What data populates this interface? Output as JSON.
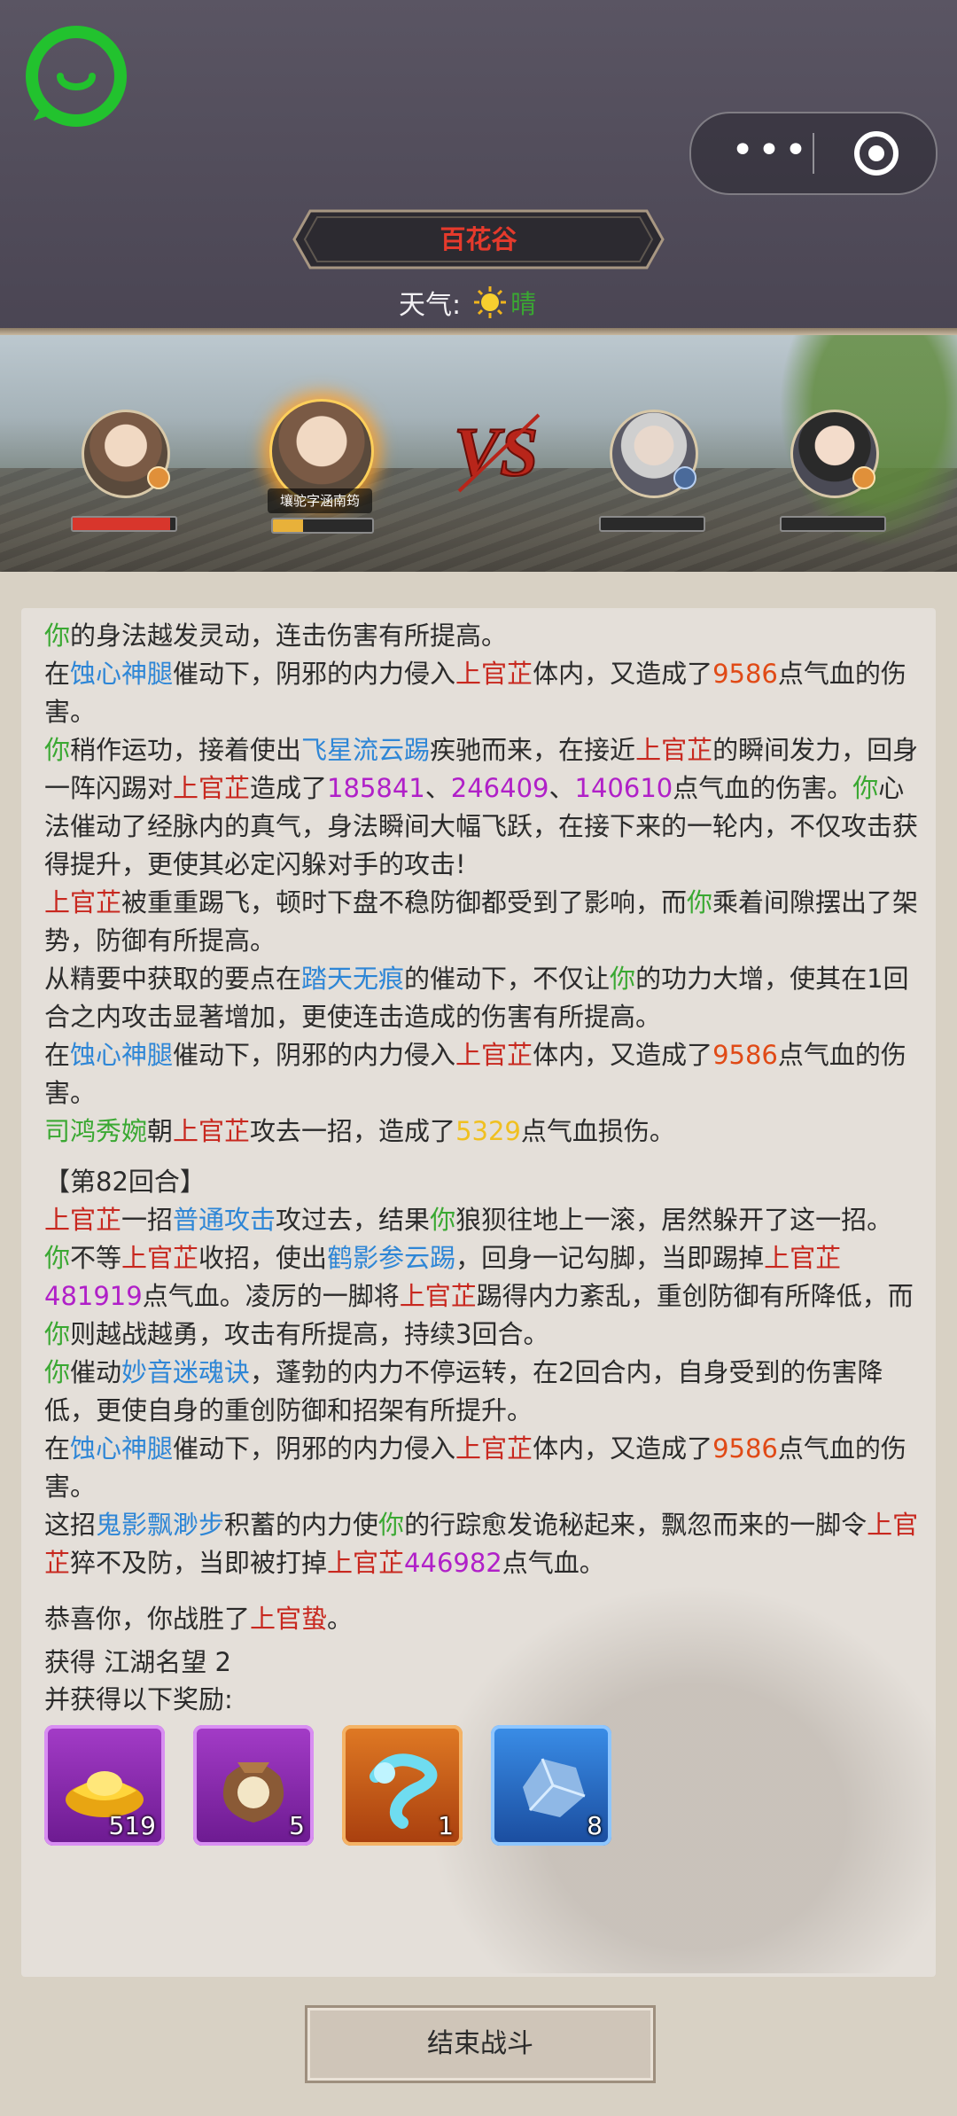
{
  "header": {
    "location": "百花谷",
    "weather_label": "天气:",
    "weather_value": "晴",
    "weather_icon": "sun-icon",
    "menu_icon": "more-dots-icon",
    "close_icon": "target-icon"
  },
  "battle": {
    "vs_text": "VS",
    "active_name": "壤驼字涵南筠",
    "left_team": [
      {
        "portrait": "female-warrior-portrait",
        "hp_fraction": 0.95
      },
      {
        "portrait": "fire-aura-hero-portrait",
        "hp_fraction": 0.3
      }
    ],
    "right_team": [
      {
        "portrait": "elder-portrait",
        "hp_fraction": 0
      },
      {
        "portrait": "female-scholar-portrait",
        "hp_fraction": 0
      }
    ]
  },
  "log": {
    "round_label": "【第82回合】",
    "lines": {
      "l1": [
        "你",
        "的身法越发灵动，连击伤害有所提高。"
      ],
      "l2": [
        "在",
        "蚀心神腿",
        "催动下，阴邪的内力侵入",
        "上官芷",
        "体内，又造成了",
        "9586",
        "点气血的伤害。"
      ],
      "l3": [
        "你",
        "稍作运功，接着使出",
        "飞星流云踢",
        "疾驰而来，在接近",
        "上官芷",
        "的瞬间发力，回身一阵闪踢对",
        "上官芷",
        "造成了",
        "185841",
        "、",
        "246409",
        "、",
        "140610",
        "点气血的伤害。",
        "你",
        "心法催动了经脉内的真气，身法瞬间大幅飞跃，在接下来的一轮内，不仅攻击获得提升，更使其必定闪躲对手的攻击!"
      ],
      "l4": [
        "上官芷",
        "被重重踢飞，顿时下盘不稳防御都受到了影响，而",
        "你",
        "乘着间隙摆出了架势，防御有所提高。"
      ],
      "l5": [
        "从精要中获取的要点在",
        "踏天无痕",
        "的催动下，不仅让",
        "你",
        "的功力大增，使其在1回合之内攻击显著增加，更使连击造成的伤害有所提高。"
      ],
      "l6": [
        "在",
        "蚀心神腿",
        "催动下，阴邪的内力侵入",
        "上官芷",
        "体内，又造成了",
        "9586",
        "点气血的伤害。"
      ],
      "l7": [
        "司鸿秀婉",
        "朝",
        "上官芷",
        "攻去一招，造成了",
        "5329",
        "点气血损伤。"
      ],
      "l8": [
        "上官芷",
        "一招",
        "普通攻击",
        "攻过去，结果",
        "你",
        "狼狈往地上一滚，居然躲开了这一招。"
      ],
      "l9": [
        "你",
        "不等",
        "上官芷",
        "收招，使出",
        "鹤影参云踢",
        "，回身一记勾脚，当即踢掉",
        "上官芷",
        "481919",
        "点气血。凌厉的一脚将",
        "上官芷",
        "踢得内力紊乱，重创防御有所降低，而",
        "你",
        "则越战越勇，攻击有所提高，持续3回合。"
      ],
      "l10": [
        "你",
        "催动",
        "妙音迷魂诀",
        "，蓬勃的内力不停运转，在2回合内，自身受到的伤害降低，更使自身的重创防御和招架有所提升。"
      ],
      "l11": [
        "在",
        "蚀心神腿",
        "催动下，阴邪的内力侵入",
        "上官芷",
        "体内，又造成了",
        "9586",
        "点气血的伤害。"
      ],
      "l12": [
        "这招",
        "鬼影飘渺步",
        "积蓄的内力使",
        "你",
        "的行踪愈发诡秘起来，飘忽而来的一脚令",
        "上官芷",
        "猝不及防，当即被打掉",
        "上官芷",
        "446982",
        "点气血。"
      ],
      "l13": [
        "恭喜你，你战胜了",
        "上官蛰",
        "。"
      ]
    }
  },
  "rewards": {
    "fame_label": "获得",
    "fame_value": "江湖名望 2",
    "extra_label": "并获得以下奖励:",
    "items": [
      {
        "icon": "gold-ingot-icon",
        "count": "519",
        "quality": "purple"
      },
      {
        "icon": "pouch-icon",
        "count": "5",
        "quality": "purple"
      },
      {
        "icon": "cyan-swirl-icon",
        "count": "1",
        "quality": "orange"
      },
      {
        "icon": "blue-stone-icon",
        "count": "8",
        "quality": "blue"
      }
    ]
  },
  "footer": {
    "end_button": "结束战斗"
  },
  "colors": {
    "player": "#3aa832",
    "skill": "#2e86d6",
    "enemy": "#c8281f",
    "damage": "#b020c8",
    "ally_damage": "#f0c020",
    "location": "#e53a2c"
  }
}
